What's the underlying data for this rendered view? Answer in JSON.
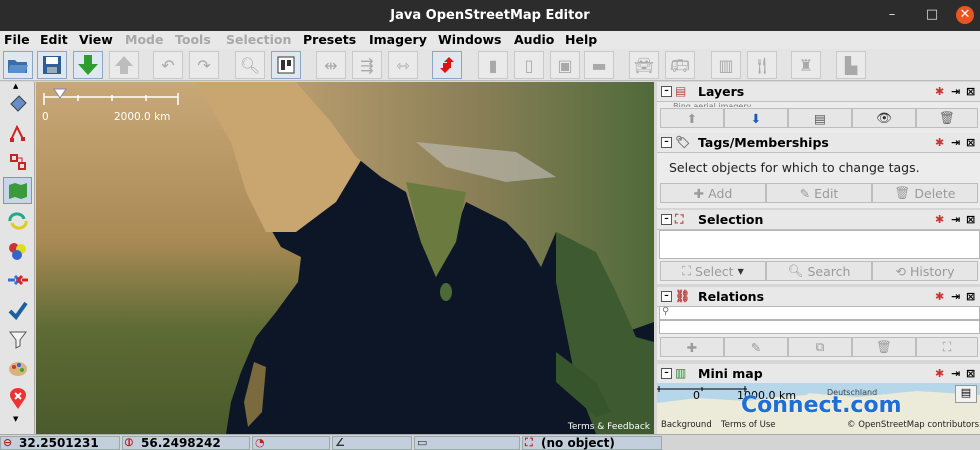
{
  "window": {
    "title": "Java OpenStreetMap Editor",
    "minimize": "–",
    "maximize": "□",
    "close": "✕"
  },
  "menu": [
    {
      "label": "File",
      "enabled": true
    },
    {
      "label": "Edit",
      "enabled": true
    },
    {
      "label": "View",
      "enabled": true
    },
    {
      "label": "Mode",
      "enabled": false
    },
    {
      "label": "Tools",
      "enabled": false
    },
    {
      "label": "Selection",
      "enabled": false
    },
    {
      "label": "Presets",
      "enabled": true
    },
    {
      "label": "Imagery",
      "enabled": true
    },
    {
      "label": "Windows",
      "enabled": true
    },
    {
      "label": "Audio",
      "enabled": true
    },
    {
      "label": "Help",
      "enabled": true
    }
  ],
  "toolbar_icons": [
    "open-icon",
    "save-icon",
    "download-icon",
    "upload-icon",
    "undo-icon",
    "redo-icon",
    "zoom-icon",
    "preferences-icon",
    "split-way-icon",
    "combine-way-icon",
    "align-icon",
    "reverse-way-icon",
    "building-icon",
    "building-icon",
    "shop-icon",
    "highway-icon",
    "car-icon",
    "bus-icon",
    "toilets-icon",
    "restaurant-icon",
    "castle-icon",
    "industrial-icon"
  ],
  "map": {
    "scale_label": "2000.0 km",
    "scale_zero": "0",
    "attribution": "Terms & Feedback"
  },
  "status": {
    "lat": "32.2501231",
    "lon": "56.2498242",
    "selection": "(no object)"
  },
  "layers": {
    "title": "Layers",
    "row_text": "Bing aerial imagery"
  },
  "tags": {
    "title": "Tags/Memberships",
    "message": "Select objects for which to change tags.",
    "add": "Add",
    "edit": "Edit",
    "delete": "Delete"
  },
  "selection": {
    "title": "Selection",
    "select": "Select",
    "search": "Search",
    "history": "History"
  },
  "relations": {
    "title": "Relations"
  },
  "minimap": {
    "title": "Mini map",
    "scale_zero": "0",
    "scale_label": "1000.0 km",
    "country": "Deutschland",
    "background": "Background",
    "terms": "Terms of Use",
    "credit": "© OpenStreetMap contributors",
    "watermark": "Connect.com"
  },
  "colors": {
    "titlebar": "#2c2c2c",
    "close": "#e95420",
    "ocean": "#0d1626",
    "status_field": "#c3cfdc"
  }
}
